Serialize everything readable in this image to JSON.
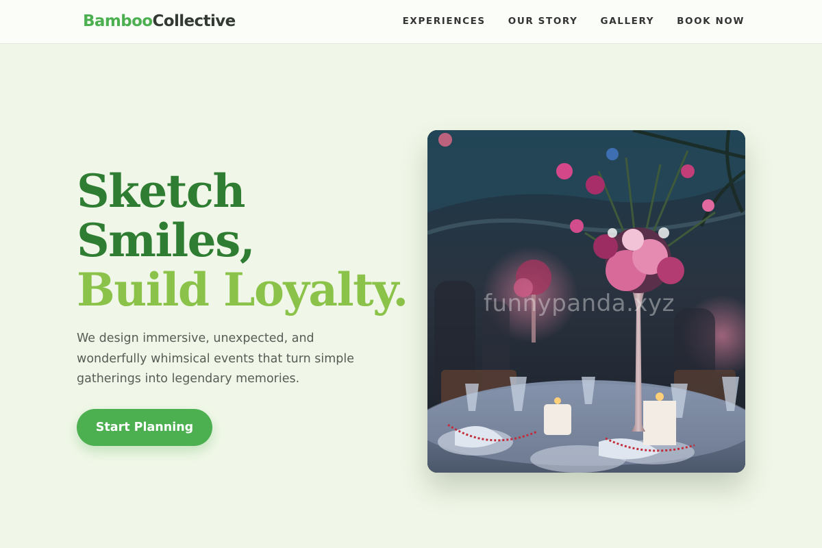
{
  "header": {
    "logo": {
      "part1": "Bamboo",
      "part2": "Collective"
    },
    "nav": [
      {
        "label": "EXPERIENCES"
      },
      {
        "label": "OUR STORY"
      },
      {
        "label": "GALLERY"
      },
      {
        "label": "BOOK NOW"
      }
    ]
  },
  "hero": {
    "title_line1": "Sketch",
    "title_line2": "Smiles,",
    "title_line3": "Build Loyalty.",
    "description": "We design immersive, unexpected, and wonderfully whimsical events that turn simple gatherings into legendary memories.",
    "cta_label": "Start Planning",
    "image": {
      "alt": "Elegant banquet table with tall floral centerpiece and candles",
      "watermark": "funnypanda.xyz"
    }
  },
  "colors": {
    "background": "#f1f7e8",
    "header_bg": "#fbfdf9",
    "brand_green": "#4caf50",
    "title_dark_green": "#2e7d32",
    "title_light_green": "#8bc34a",
    "text_gray": "#555c55"
  }
}
